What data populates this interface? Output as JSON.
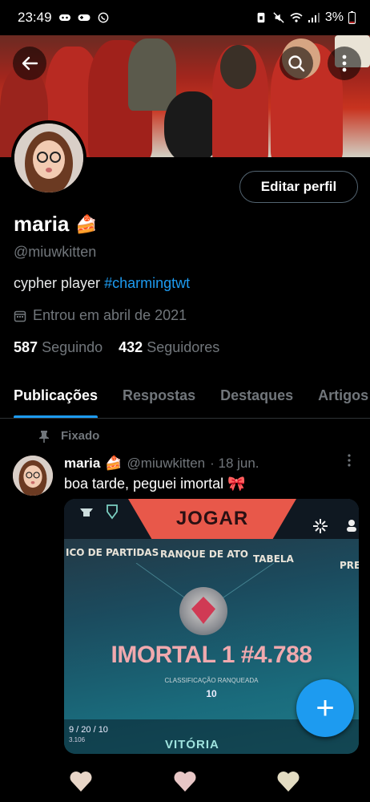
{
  "status_bar": {
    "time": "23:49",
    "battery": "3%"
  },
  "profile": {
    "name": "maria",
    "name_emoji": "🍰",
    "handle": "@miuwkitten",
    "bio_text": "cypher player ",
    "bio_hashtag": "#charmingtwt",
    "joined": "Entrou em abril de 2021",
    "following_count": "587",
    "following_label": "Seguindo",
    "followers_count": "432",
    "followers_label": "Seguidores",
    "edit_button": "Editar perfil"
  },
  "tabs": [
    {
      "label": "Publicações",
      "active": true
    },
    {
      "label": "Respostas",
      "active": false
    },
    {
      "label": "Destaques",
      "active": false
    },
    {
      "label": "Artigos",
      "active": false
    }
  ],
  "pinned_label": "Fixado",
  "post": {
    "author": "maria",
    "author_emoji": "🍰",
    "handle": "@miuwkitten",
    "date": "· 18 jun.",
    "text": "boa tarde, peguei imortal 🎀",
    "media": {
      "header": "JOGAR",
      "subtabs": [
        "ICO DE PARTIDAS",
        "RANQUE DE ATO",
        "TABELA",
        "PRE"
      ],
      "rank": "IMORTAL 1 #4.788",
      "rank_caption": "CLASSIFICAÇÃO RANQUEADA",
      "rank_points": "10",
      "kda": "9 / 20 / 10",
      "kda_sub": "3.106",
      "result": "VITÓRIA"
    }
  },
  "fab_label": "+",
  "colors": {
    "accent": "#1d9bf0",
    "muted": "#71767b",
    "border": "#2f3336"
  }
}
